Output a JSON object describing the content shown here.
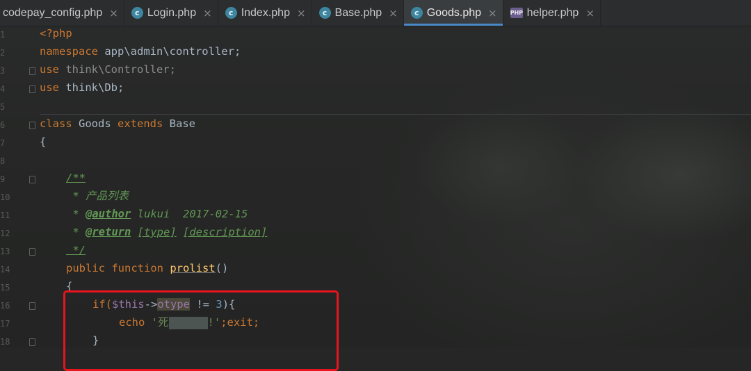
{
  "tabs": [
    {
      "label": "codepay_config.php",
      "icon": "",
      "icon_name": "php-file-icon",
      "active": false
    },
    {
      "label": "Login.php",
      "icon": "c",
      "icon_name": "class-icon",
      "active": false
    },
    {
      "label": "Index.php",
      "icon": "c",
      "icon_name": "class-icon",
      "active": false
    },
    {
      "label": "Base.php",
      "icon": "c",
      "icon_name": "class-icon",
      "active": false
    },
    {
      "label": "Goods.php",
      "icon": "c",
      "icon_name": "class-icon",
      "active": true
    },
    {
      "label": "helper.php",
      "icon": "PHP",
      "icon_name": "php-file-icon",
      "active": false
    }
  ],
  "close_glyph": "×",
  "gutter": {
    "line_numbers": [
      "1",
      "2",
      "3",
      "4",
      "5",
      "6",
      "7",
      "8",
      "9",
      "10",
      "11",
      "12",
      "13",
      "14",
      "15",
      "16",
      "17",
      "18"
    ]
  },
  "code": {
    "php_open": "<?php",
    "namespace_kw": "namespace",
    "namespace_val": " app\\admin\\controller;",
    "use_kw": "use",
    "use1_val": " think\\Controller;",
    "use2_val": " think\\Db;",
    "class_kw": "class",
    "class_name": " Goods ",
    "extends_kw": "extends",
    "base_name": " Base",
    "open_brace": "{",
    "doc_open": "/**",
    "doc_line1": " * 产品列表",
    "doc_star": " * ",
    "author_tag": "@author",
    "author_val": " lukui  2017-02-15",
    "return_tag": "@return",
    "return_sp": " ",
    "return_type": "[type]",
    "return_desc": "[description]",
    "doc_close": " */",
    "public_kw": "public",
    "function_kw": " function ",
    "fn_name": "prolist",
    "fn_parens": "()",
    "fn_brace": "{",
    "if_kw": "if(",
    "this_var": "$this",
    "arrow": "->",
    "otype_prop": "otype",
    "neq": " != ",
    "num_3": "3",
    "if_close": "){",
    "echo_kw": "echo ",
    "str_start": "'死",
    "str_end": "!'",
    "exit_part": ";exit;",
    "close_brace": "}"
  }
}
